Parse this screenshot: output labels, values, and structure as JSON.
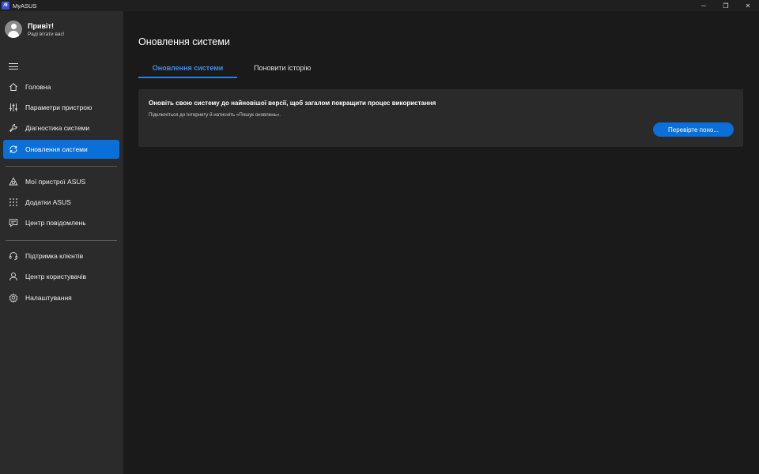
{
  "window": {
    "logo_text": "/6",
    "title": "MyASUS",
    "minimize": "─",
    "restore": "❐",
    "close": "✕"
  },
  "profile": {
    "greeting": "Привіт!",
    "subtitle": "Раді вітати вас!"
  },
  "sidebar": {
    "items": [
      {
        "label": "Головна",
        "icon": "home-icon"
      },
      {
        "label": "Параметри пристрою",
        "icon": "sliders-icon"
      },
      {
        "label": "Діагностика системи",
        "icon": "wrench-icon"
      },
      {
        "label": "Оновлення системи",
        "icon": "update-icon",
        "active": true
      },
      {
        "label": "Мої пристрої ASUS",
        "icon": "devices-icon"
      },
      {
        "label": "Додатки ASUS",
        "icon": "apps-grid-icon"
      },
      {
        "label": "Центр повідомлень",
        "icon": "message-icon"
      },
      {
        "label": "Підтримка клієнтів",
        "icon": "headset-icon"
      },
      {
        "label": "Центр користувачів",
        "icon": "user-icon"
      },
      {
        "label": "Налаштування",
        "icon": "gear-icon"
      }
    ]
  },
  "main": {
    "title": "Оновлення системи",
    "tabs": [
      {
        "label": "Оновлення системи",
        "active": true
      },
      {
        "label": "Поновити історію",
        "active": false
      }
    ],
    "card": {
      "title": "Оновіть свою систему до найновішої версії, щоб загалом покращити процес використання",
      "subtitle": "Підключіться до Інтернету й натисніть «Пошук оновлень».",
      "button": "Перевірте поно..."
    }
  },
  "colors": {
    "accent": "#0a6fd8",
    "tab_active": "#3d8fe8",
    "sidebar_bg": "#2b2b2b",
    "main_bg": "#1a1a1a",
    "card_bg": "#2a2a2a"
  }
}
